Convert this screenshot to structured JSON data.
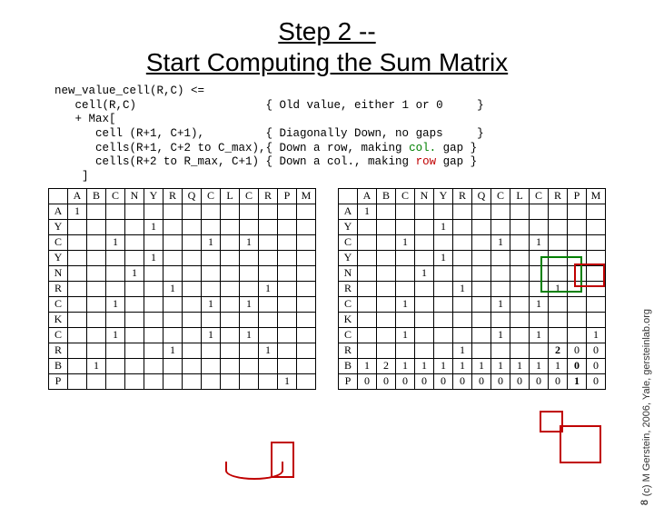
{
  "title_line1": "Step 2 --",
  "title_line2": "Start Computing the Sum Matrix",
  "code": {
    "l1": "new_value_cell(R,C) <=",
    "l2": "   cell(R,C)                   { Old value, either 1 or 0     }",
    "l3": "   + Max[",
    "l4a": "      cell (R+1, C+1),         { Diagonally Down, no gaps     }",
    "l5a": "      cells(R+1, C+2 to C_max),{ Down a row, making ",
    "l5b": "col.",
    "l5c": " gap }",
    "l6a": "      cells(R+2 to R_max, C+1) { Down a col., making ",
    "l6b": "row",
    "l6c": " gap }",
    "l7": "    ]"
  },
  "columns": [
    "A",
    "B",
    "C",
    "N",
    "Y",
    "R",
    "Q",
    "C",
    "L",
    "C",
    "R",
    "P",
    "M"
  ],
  "rows": [
    "A",
    "Y",
    "C",
    "Y",
    "N",
    "R",
    "C",
    "K",
    "C",
    "R",
    "B",
    "P"
  ],
  "matrix1": [
    [
      "1",
      "",
      "",
      "",
      "",
      "",
      "",
      "",
      "",
      "",
      "",
      "",
      ""
    ],
    [
      "",
      "",
      "",
      "",
      "1",
      "",
      "",
      "",
      "",
      "",
      "",
      "",
      ""
    ],
    [
      "",
      "",
      "1",
      "",
      "",
      "",
      "",
      "1",
      "",
      "1",
      "",
      "",
      ""
    ],
    [
      "",
      "",
      "",
      "",
      "1",
      "",
      "",
      "",
      "",
      "",
      "",
      "",
      ""
    ],
    [
      "",
      "",
      "",
      "1",
      "",
      "",
      "",
      "",
      "",
      "",
      "",
      "",
      ""
    ],
    [
      "",
      "",
      "",
      "",
      "",
      "1",
      "",
      "",
      "",
      "",
      "1",
      "",
      ""
    ],
    [
      "",
      "",
      "1",
      "",
      "",
      "",
      "",
      "1",
      "",
      "1",
      "",
      "",
      ""
    ],
    [
      "",
      "",
      "",
      "",
      "",
      "",
      "",
      "",
      "",
      "",
      "",
      "",
      ""
    ],
    [
      "",
      "",
      "1",
      "",
      "",
      "",
      "",
      "1",
      "",
      "1",
      "",
      "",
      ""
    ],
    [
      "",
      "",
      "",
      "",
      "",
      "1",
      "",
      "",
      "",
      "",
      "1",
      "",
      ""
    ],
    [
      "",
      "1",
      "",
      "",
      "",
      "",
      "",
      "",
      "",
      "",
      "",
      "",
      ""
    ],
    [
      "",
      "",
      "",
      "",
      "",
      "",
      "",
      "",
      "",
      "",
      "",
      "1",
      ""
    ]
  ],
  "matrix2": [
    [
      "1",
      "",
      "",
      "",
      "",
      "",
      "",
      "",
      "",
      "",
      "",
      "",
      ""
    ],
    [
      "",
      "",
      "",
      "",
      "1",
      "",
      "",
      "",
      "",
      "",
      "",
      "",
      ""
    ],
    [
      "",
      "",
      "1",
      "",
      "",
      "",
      "",
      "1",
      "",
      "1",
      "",
      "",
      ""
    ],
    [
      "",
      "",
      "",
      "",
      "1",
      "",
      "",
      "",
      "",
      "",
      "",
      "",
      ""
    ],
    [
      "",
      "",
      "",
      "1",
      "",
      "",
      "",
      "",
      "",
      "",
      "",
      "",
      ""
    ],
    [
      "",
      "",
      "",
      "",
      "",
      "1",
      "",
      "",
      "",
      "",
      "1",
      "",
      ""
    ],
    [
      "",
      "",
      "1",
      "",
      "",
      "",
      "",
      "1",
      "",
      "1",
      "",
      "",
      ""
    ],
    [
      "",
      "",
      "",
      "",
      "",
      "",
      "",
      "",
      "",
      "",
      "",
      "",
      ""
    ],
    [
      "",
      "",
      "1",
      "",
      "",
      "",
      "",
      "1",
      "",
      "1",
      "",
      "",
      "1"
    ],
    [
      "",
      "",
      "",
      "",
      "",
      "1",
      "",
      "",
      "",
      "",
      "2",
      "0",
      "0"
    ],
    [
      "1",
      "2",
      "1",
      "1",
      "1",
      "1",
      "1",
      "1",
      "1",
      "1",
      "1",
      "0",
      "0"
    ],
    [
      "0",
      "0",
      "0",
      "0",
      "0",
      "0",
      "0",
      "0",
      "0",
      "0",
      "0",
      "1",
      "0"
    ]
  ],
  "boldCells2": [
    [
      9,
      10
    ],
    [
      10,
      11
    ],
    [
      11,
      11
    ]
  ],
  "footer": "(c) M Gerstein, 2006, Yale, gersteinlab.org",
  "page_num": "8"
}
